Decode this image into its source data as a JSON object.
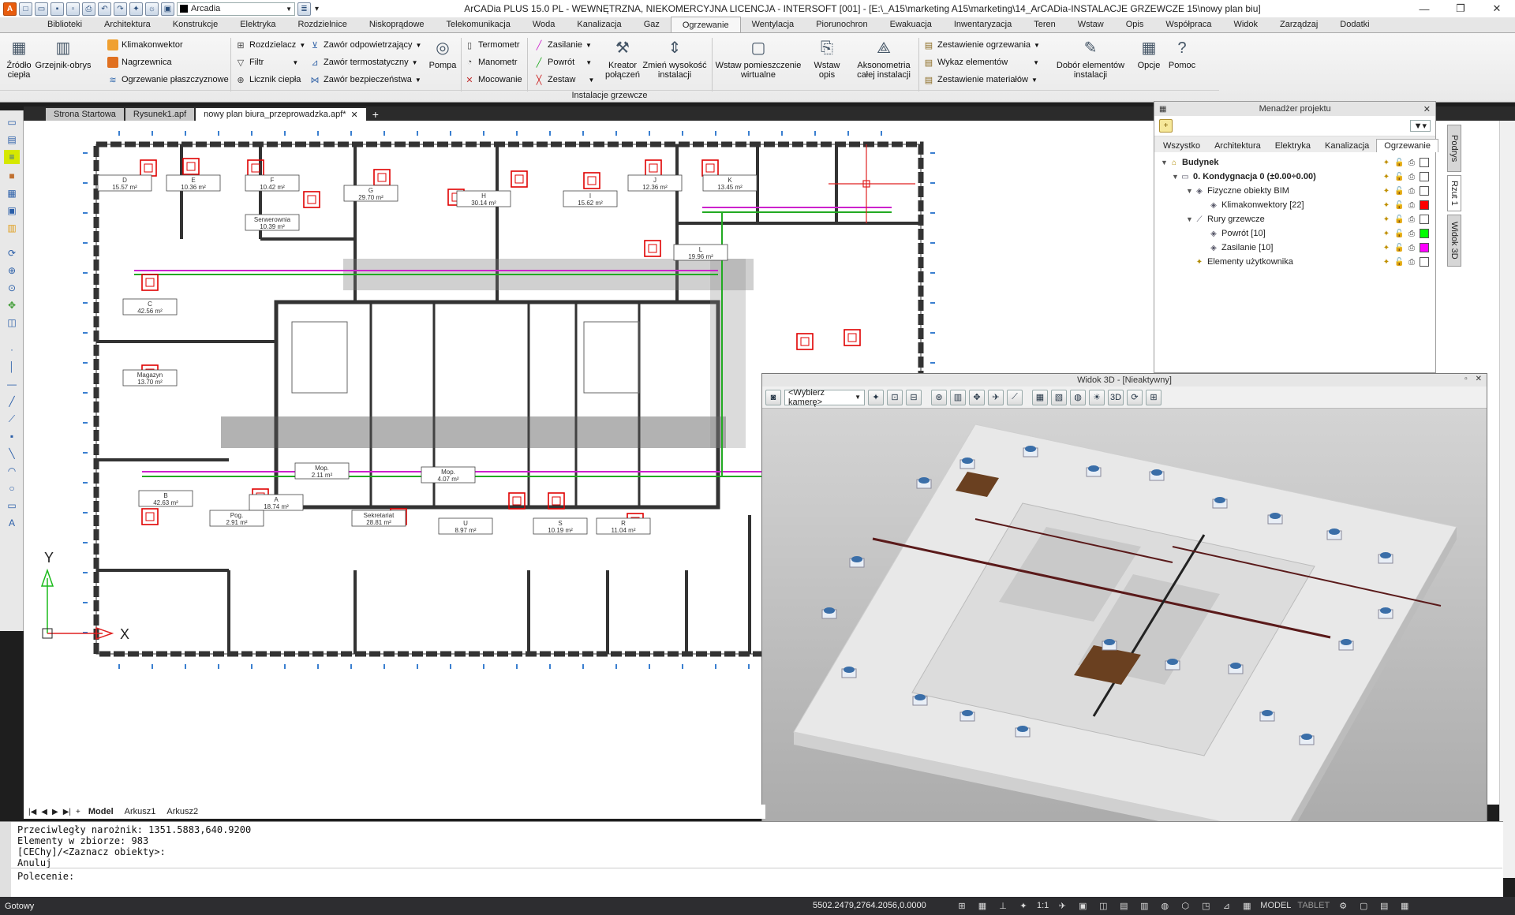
{
  "window": {
    "title": "ArCADia PLUS 15.0 PL - WEWNĘTRZNA, NIEKOMERCYJNA LICENCJA - INTERSOFT [001] - [E:\\_A15\\marketing A15\\marketing\\14_ArCADia-INSTALACJE GRZEWCZE 15\\nowy plan biu]",
    "layer_combo": "Arcadia",
    "controls": [
      "—",
      "❐",
      "✕"
    ]
  },
  "ribbon_tabs": [
    "Biblioteki",
    "Architektura",
    "Konstrukcje",
    "Elektryka",
    "Rozdzielnice",
    "Niskoprądowe",
    "Telekomunikacja",
    "Woda",
    "Kanalizacja",
    "Gaz",
    "Ogrzewanie",
    "Wentylacja",
    "Piorunochron",
    "Ewakuacja",
    "Inwentaryzacja",
    "Teren",
    "Wstaw",
    "Opis",
    "Współpraca",
    "Widok",
    "Zarządzaj",
    "Dodatki"
  ],
  "ribbon_active_tab": "Ogrzewanie",
  "ribbon": {
    "zrodlo": "Źródło ciepła",
    "grzejnik": "Grzejnik-obrys",
    "klimakonwektor": "Klimakonwektor",
    "nagrzewnica": "Nagrzewnica",
    "ogrzewanie_plaszczyzn": "Ogrzewanie płaszczyznowe",
    "rozdzielacz": "Rozdzielacz",
    "filtr": "Filtr",
    "licznik": "Licznik ciepła",
    "zawor_odp": "Zawór odpowietrzający",
    "zawor_term": "Zawór termostatyczny",
    "zawor_bezp": "Zawór bezpieczeństwa",
    "pompa": "Pompa",
    "termometr": "Termometr",
    "manometr": "Manometr",
    "mocowanie": "Mocowanie",
    "zasilanie": "Zasilanie",
    "powrot": "Powrót",
    "zestaw": "Zestaw",
    "kreator": "Kreator połączeń",
    "zmien": "Zmień wysokość instalacji",
    "wstaw_pom": "Wstaw pomieszczenie wirtualne",
    "wstaw_opis": "Wstaw opis",
    "aksonometria": "Aksonometria całej instalacji",
    "zestawienie_ogrz": "Zestawienie ogrzewania",
    "wykaz": "Wykaz elementów",
    "zestawienie_mat": "Zestawienie materiałów",
    "dobor": "Dobór elementów instalacji",
    "opcje": "Opcje",
    "pomoc": "Pomoc",
    "group_label": "Instalacje grzewcze"
  },
  "doc_tabs": [
    "Strona Startowa",
    "Rysunek1.apf",
    "nowy plan biura_przeprowadzka.apf*"
  ],
  "doc_tab_active": 2,
  "rooms": [
    {
      "id": "D",
      "area": "15.57 m²"
    },
    {
      "id": "E",
      "area": "10.36 m²"
    },
    {
      "id": "F",
      "area": "10.42 m²"
    },
    {
      "id": "G",
      "area": "29.70 m²"
    },
    {
      "id": "H",
      "area": "30.14 m²"
    },
    {
      "id": "I",
      "area": "15.62 m²"
    },
    {
      "id": "J",
      "area": "12.36 m²"
    },
    {
      "id": "K",
      "area": "13.45 m²"
    },
    {
      "id": "L",
      "area": "19.96 m²"
    },
    {
      "id": "Serwerownia",
      "area": "10.39 m²"
    },
    {
      "id": "C",
      "area": "42.56 m²"
    },
    {
      "id": "Magazyn",
      "area": "13.70 m²"
    },
    {
      "id": "B",
      "area": "42.63 m²"
    },
    {
      "id": "A",
      "area": "18.74 m²"
    },
    {
      "id": "Pog.",
      "area": "2.91 m²"
    },
    {
      "id": "Sekretariat",
      "area": "28.81 m²"
    },
    {
      "id": "U",
      "area": "8.97 m²"
    },
    {
      "id": "S",
      "area": "10.19 m²"
    },
    {
      "id": "R",
      "area": "11.04 m²"
    },
    {
      "id": "Mop.",
      "area": "2.11 m²"
    },
    {
      "id": "Mop.",
      "area": "4.07 m²"
    }
  ],
  "axis": {
    "x": "X",
    "y": "Y"
  },
  "project_manager": {
    "title": "Menadżer projektu",
    "tabs": [
      "Wszystko",
      "Architektura",
      "Elektryka",
      "Kanalizacja",
      "Ogrzewanie"
    ],
    "active_tab": "Ogrzewanie",
    "tree": [
      {
        "label": "Budynek",
        "bold": true,
        "color": "#ffffff"
      },
      {
        "label": "0. Kondygnacja 0 (±0.00÷0.00)",
        "bold": true,
        "color": "#ffffff"
      },
      {
        "label": "Fizyczne obiekty BIM",
        "bold": false,
        "color": "#ffffff"
      },
      {
        "label": "Klimakonwektory [22]",
        "bold": false,
        "color": "#ff0000"
      },
      {
        "label": "Rury grzewcze",
        "bold": false,
        "color": "#ffffff"
      },
      {
        "label": "Powrót [10]",
        "bold": false,
        "color": "#00ff00"
      },
      {
        "label": "Zasilanie [10]",
        "bold": false,
        "color": "#ff00ff"
      },
      {
        "label": "Elementy użytkownika",
        "bold": false,
        "color": "#ffffff"
      }
    ]
  },
  "side_tabs": [
    "Podrys",
    "Rzut 1",
    "Widok 3D"
  ],
  "side_tab_active": "Rzut 1",
  "view3d": {
    "title": "Widok 3D - [Nieaktywny]",
    "camera": "<Wybierz kamerę>"
  },
  "layout_tabs": [
    "Model",
    "Arkusz1",
    "Arkusz2"
  ],
  "layout_active": "Model",
  "command_history": [
    "Przeciwległy narożnik: 1351.5883,640.9200",
    "Elementy w zbiorze: 983",
    "[CEChy]/<Zaznacz obiekty>:",
    "Anuluj"
  ],
  "command_prompt": "Polecenie:",
  "status": {
    "ready": "Gotowy",
    "coords": "5502.2479,2764.2056,0.0000",
    "scale": "1:1",
    "model": "MODEL",
    "tablet": "TABLET"
  },
  "colors": {
    "pipe_supply": "#cc22cc",
    "pipe_return": "#22aa22",
    "heater": "#e00000",
    "dimension": "#3a7fd0",
    "accent": "#e85c0d"
  }
}
